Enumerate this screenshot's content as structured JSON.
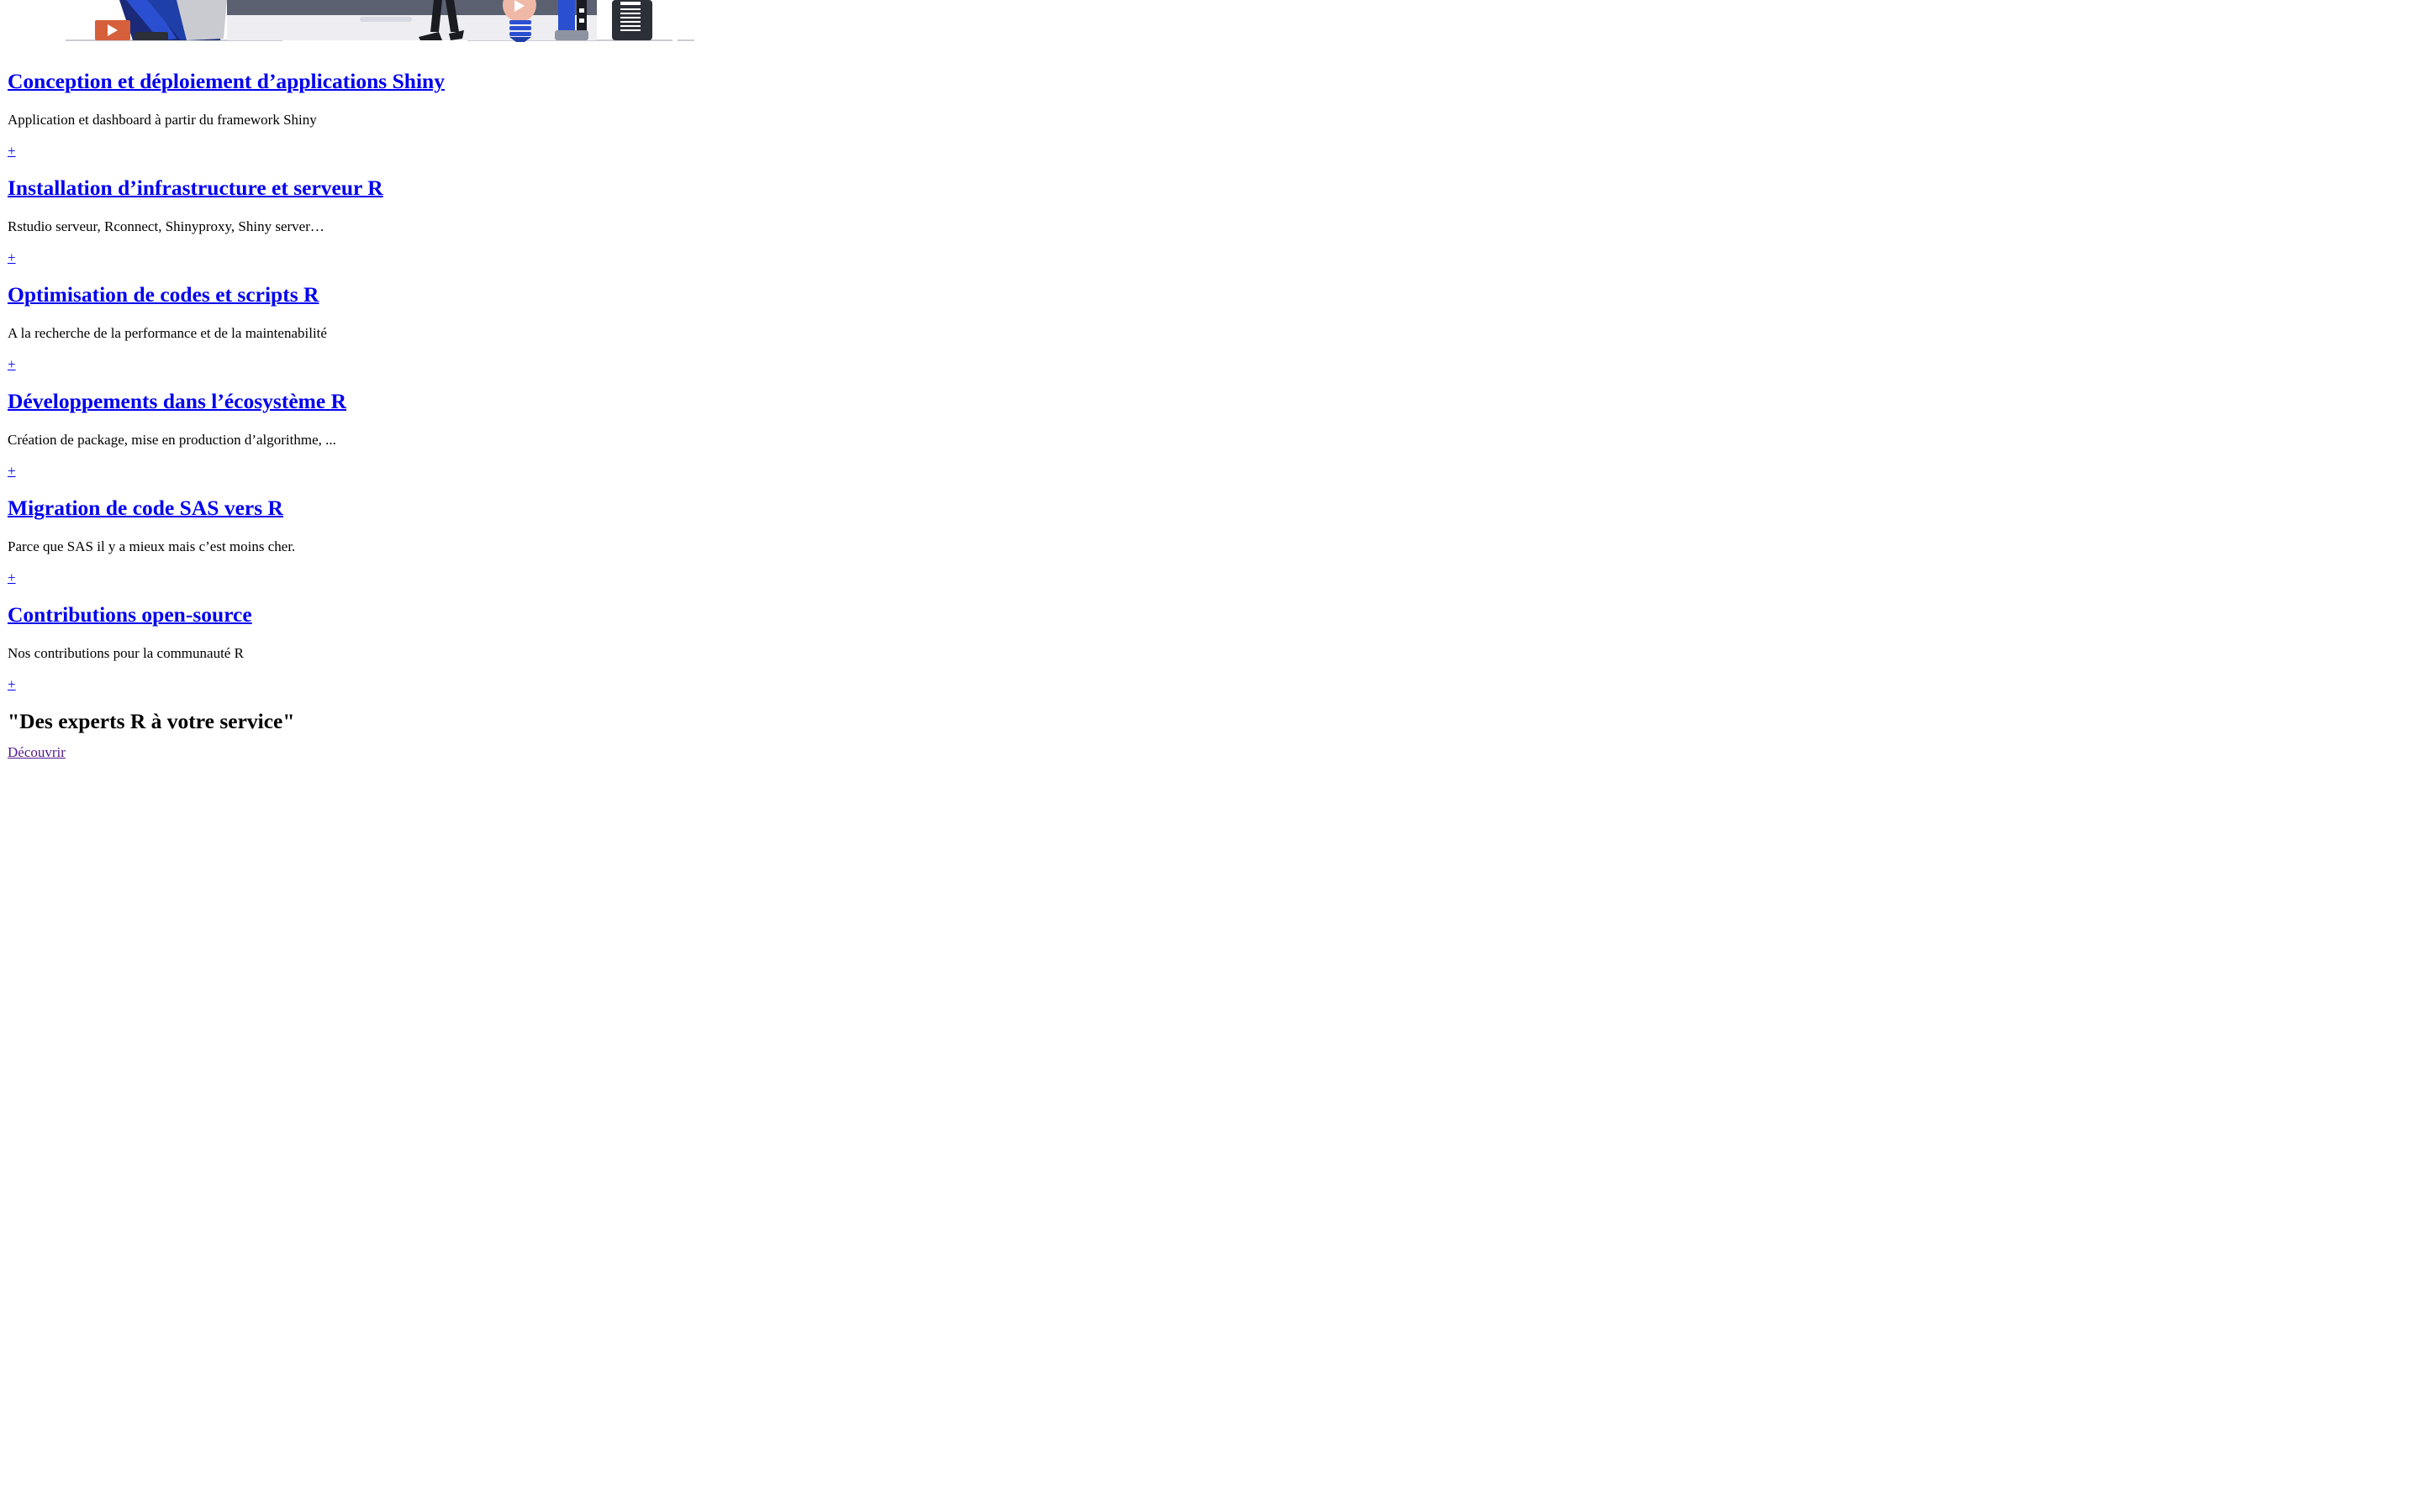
{
  "services": [
    {
      "title": "Conception et déploiement d’applications Shiny",
      "description": "Application et dashboard à partir du framework Shiny",
      "more_label": "+"
    },
    {
      "title": "Installation d’infrastructure et serveur R",
      "description": "Rstudio serveur, Rconnect, Shinyproxy, Shiny server…",
      "more_label": "+"
    },
    {
      "title": "Optimisation de codes et scripts R",
      "description": "A la recherche de la performance et de la maintenabilité",
      "more_label": "+"
    },
    {
      "title": "Développements dans l’écosystème R",
      "description": "Création de package, mise en production d’algorithme, ...",
      "more_label": "+"
    },
    {
      "title": "Migration de code SAS vers R",
      "description": "Parce que SAS il y a mieux mais c’est moins cher.",
      "more_label": "+"
    },
    {
      "title": "Contributions open-source",
      "description": "Nos contributions pour la communauté R",
      "more_label": "+"
    }
  ],
  "tagline": "\"Des experts R à votre service\"",
  "cta": {
    "label": "Découvrir"
  },
  "hero": {
    "icon_play": "play-icon",
    "icon_heart": "heart-icon",
    "icon_bulb": "lightbulb-icon",
    "icon_document": "document-icon",
    "colors": {
      "blue": "#1f3fa8",
      "navy": "#16215a",
      "gray": "#5b6170",
      "orange": "#d65f3c",
      "light": "#e9e9ee"
    }
  }
}
